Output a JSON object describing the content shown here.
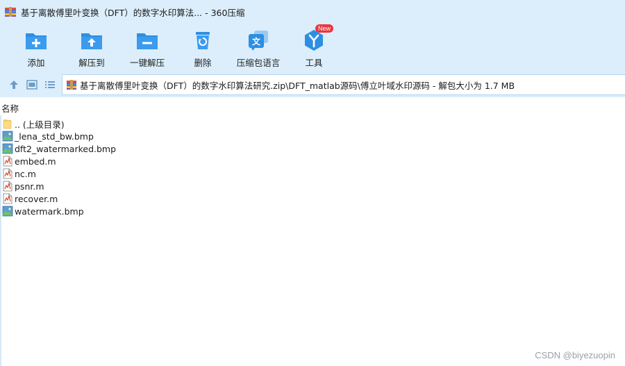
{
  "window": {
    "title": "基于离散傅里叶变换（DFT）的数字水印算法... - 360压缩"
  },
  "toolbar": {
    "items": [
      {
        "label": "添加",
        "icon": "add-folder-icon"
      },
      {
        "label": "解压到",
        "icon": "extract-to-icon"
      },
      {
        "label": "一键解压",
        "icon": "one-click-extract-icon"
      },
      {
        "label": "删除",
        "icon": "recycle-bin-icon"
      },
      {
        "label": "压缩包语言",
        "icon": "language-icon"
      },
      {
        "label": "工具",
        "icon": "tools-icon",
        "badge": "New"
      }
    ]
  },
  "address": {
    "path": "基于离散傅里叶变换（DFT）的数字水印算法研究.zip\\DFT_matlab源码\\傅立叶域水印源码 - 解包大小为 1.7 MB"
  },
  "list": {
    "column_name": "名称",
    "files": [
      {
        "name": ".. (上级目录)",
        "type": "folder"
      },
      {
        "name": "_lena_std_bw.bmp",
        "type": "bmp"
      },
      {
        "name": "dft2_watermarked.bmp",
        "type": "bmp"
      },
      {
        "name": "embed.m",
        "type": "m"
      },
      {
        "name": "nc.m",
        "type": "m"
      },
      {
        "name": "psnr.m",
        "type": "m"
      },
      {
        "name": "recover.m",
        "type": "m"
      },
      {
        "name": "watermark.bmp",
        "type": "bmp"
      }
    ]
  },
  "watermark": "CSDN @biyezuopin",
  "colors": {
    "chrome_bg": "#dceefb",
    "accent_blue": "#2d8fe3",
    "new_badge": "#e8383d"
  }
}
